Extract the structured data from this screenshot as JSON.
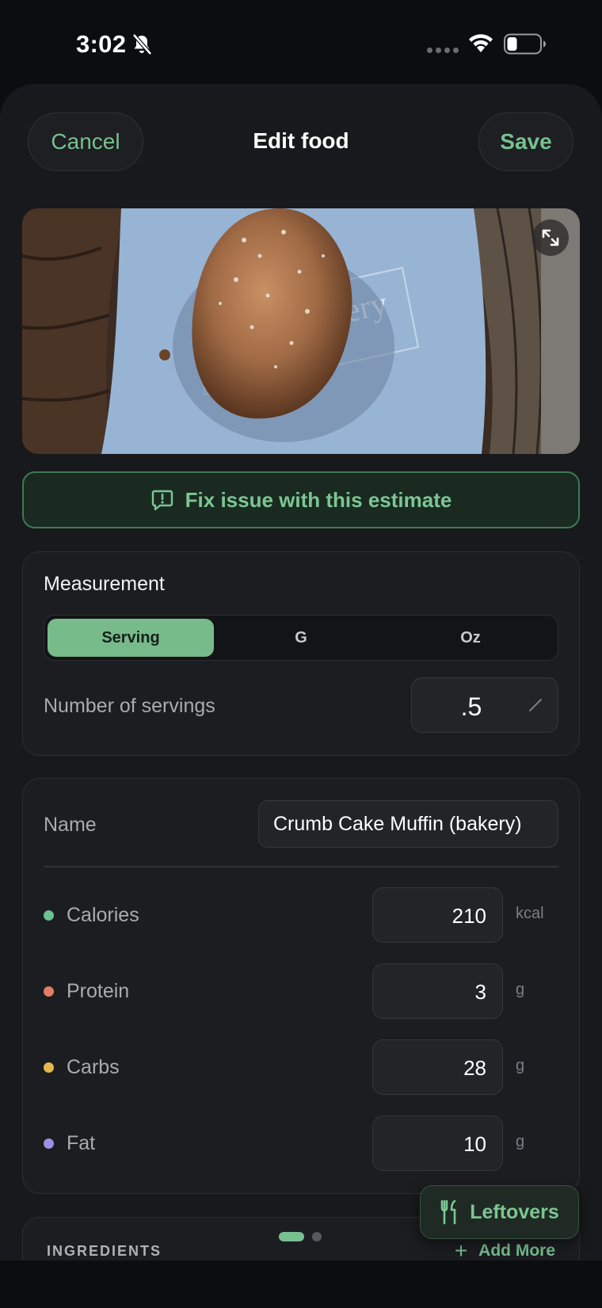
{
  "status_bar": {
    "time": "3:02"
  },
  "header": {
    "cancel_label": "Cancel",
    "title": "Edit food",
    "save_label": "Save"
  },
  "photo": {
    "description_icon": "expand-icon"
  },
  "fix_issue": {
    "label": "Fix issue with this estimate",
    "icon": "feedback-icon"
  },
  "measurement": {
    "title": "Measurement",
    "options": [
      "Serving",
      "G",
      "Oz"
    ],
    "selected": "Serving",
    "servings_label": "Number of servings",
    "servings_value": ".5"
  },
  "food": {
    "name_label": "Name",
    "name_value": "Crumb Cake Muffin (bakery)",
    "macros": [
      {
        "label": "Calories",
        "value": "210",
        "unit": "kcal",
        "color": "#6cc190"
      },
      {
        "label": "Protein",
        "value": "3",
        "unit": "g",
        "color": "#e07e69"
      },
      {
        "label": "Carbs",
        "value": "28",
        "unit": "g",
        "color": "#e3b94f"
      },
      {
        "label": "Fat",
        "value": "10",
        "unit": "g",
        "color": "#9d8ee6"
      }
    ]
  },
  "ingredients": {
    "title": "INGREDIENTS",
    "add_more_label": "Add More"
  },
  "leftovers": {
    "label": "Leftovers",
    "icon": "utensils-icon"
  },
  "colors": {
    "accent": "#78c08f",
    "background": "#18191c"
  }
}
